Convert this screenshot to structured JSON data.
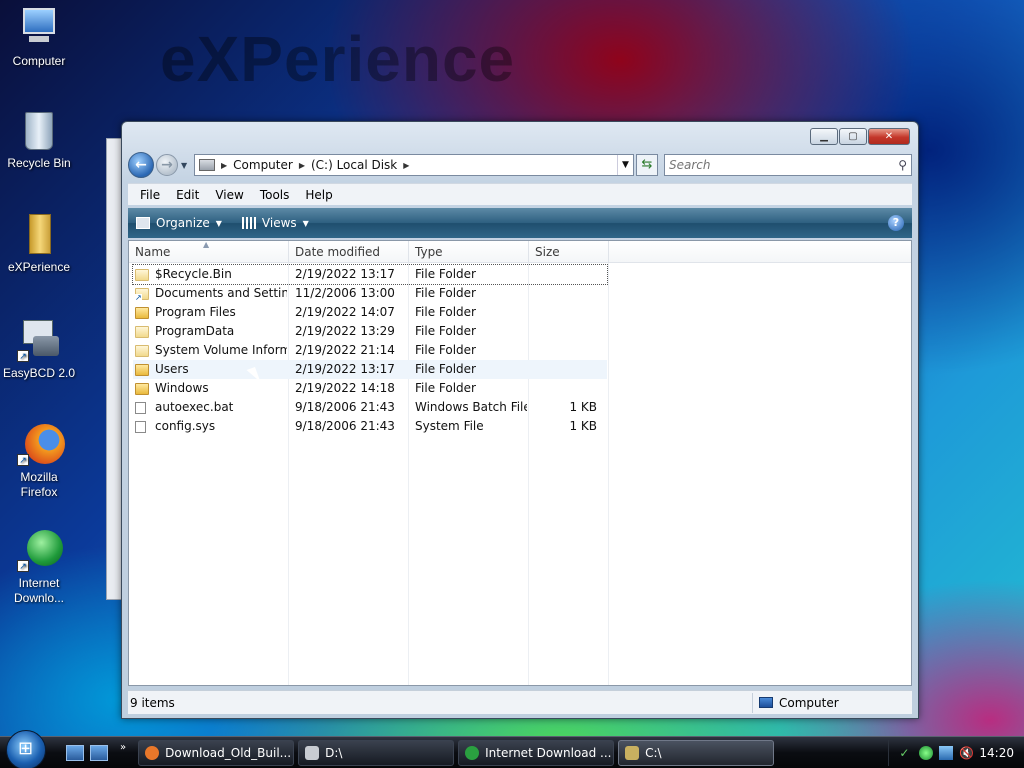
{
  "desktop": {
    "watermark": "eXPerience",
    "icons": [
      {
        "label": "Computer"
      },
      {
        "label": "Recycle Bin"
      },
      {
        "label": "eXPerience"
      },
      {
        "label": "EasyBCD 2.0"
      },
      {
        "label": "Mozilla Firefox"
      },
      {
        "label": "Internet Downlo..."
      }
    ]
  },
  "window": {
    "address": {
      "seg1": "Computer",
      "seg2": "(C:) Local Disk"
    },
    "search_placeholder": "Search",
    "menu": [
      "File",
      "Edit",
      "View",
      "Tools",
      "Help"
    ],
    "toolbar": {
      "organize": "Organize",
      "views": "Views",
      "help": "?"
    },
    "columns": {
      "name": "Name",
      "date": "Date modified",
      "type": "Type",
      "size": "Size"
    },
    "files": [
      {
        "name": "$Recycle.Bin",
        "date": "2/19/2022 13:17",
        "type": "File Folder",
        "size": "",
        "icon": "folder-light"
      },
      {
        "name": "Documents and Settings",
        "date": "11/2/2006 13:00",
        "type": "File Folder",
        "size": "",
        "icon": "folder-shortcut"
      },
      {
        "name": "Program Files",
        "date": "2/19/2022 14:07",
        "type": "File Folder",
        "size": "",
        "icon": "folder"
      },
      {
        "name": "ProgramData",
        "date": "2/19/2022 13:29",
        "type": "File Folder",
        "size": "",
        "icon": "folder-light"
      },
      {
        "name": "System Volume Inform...",
        "date": "2/19/2022 21:14",
        "type": "File Folder",
        "size": "",
        "icon": "folder-light"
      },
      {
        "name": "Users",
        "date": "2/19/2022 13:17",
        "type": "File Folder",
        "size": "",
        "icon": "folder"
      },
      {
        "name": "Windows",
        "date": "2/19/2022 14:18",
        "type": "File Folder",
        "size": "",
        "icon": "folder"
      },
      {
        "name": "autoexec.bat",
        "date": "9/18/2006 21:43",
        "type": "Windows Batch File",
        "size": "1 KB",
        "icon": "file"
      },
      {
        "name": "config.sys",
        "date": "9/18/2006 21:43",
        "type": "System File",
        "size": "1 KB",
        "icon": "file"
      }
    ],
    "status": {
      "items": "9 items",
      "location": "Computer"
    }
  },
  "taskbar": {
    "tasks": [
      {
        "label": "Download_Old_Buil...",
        "color": "#e8772a"
      },
      {
        "label": "D:\\",
        "color": "#c8ccd2"
      },
      {
        "label": "Internet Download ...",
        "color": "#2aa040"
      },
      {
        "label": "C:\\",
        "color": "#c8b060"
      }
    ],
    "clock": "14:20"
  }
}
